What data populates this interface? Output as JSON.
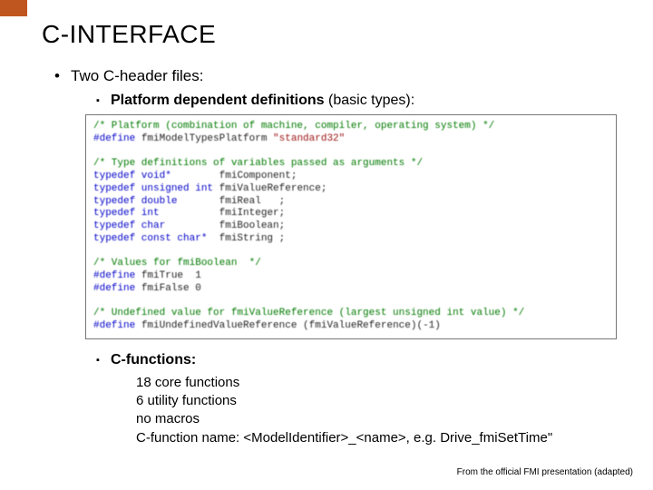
{
  "title": "C-INTERFACE",
  "l1": "Two C-header files:",
  "l2a_bold": "Platform dependent definitions",
  "l2a_rest": " (basic types):",
  "code": {
    "c1": "/* Platform (combination of machine, compiler, operating system) */",
    "d1a": "#define",
    "d1b": " fmiModelTypesPlatform ",
    "d1c": "\"standard32\"",
    "c2": "/* Type definitions of variables passed as arguments */",
    "t1a": "typedef void*",
    "t1b": "        fmiComponent;",
    "t2a": "typedef unsigned int",
    "t2b": " fmiValueReference;",
    "t3a": "typedef double",
    "t3b": "       fmiReal   ;",
    "t4a": "typedef int",
    "t4b": "          fmiInteger;",
    "t5a": "typedef char",
    "t5b": "         fmiBoolean;",
    "t6a": "typedef const char*",
    "t6b": "  fmiString ;",
    "c3": "/* Values for fmiBoolean  */",
    "d2a": "#define",
    "d2b": " fmiTrue  1",
    "d3a": "#define",
    "d3b": " fmiFalse 0",
    "c4": "/* Undefined value for fmiValueReference (largest unsigned int value) */",
    "d4a": "#define",
    "d4b": " fmiUndefinedValueReference (fmiValueReference)(-1)"
  },
  "l2b": "C-functions:",
  "l3a": "18 core functions",
  "l3b": "6 utility functions",
  "l3c": "no macros",
  "l3d": "C-function name: <ModelIdentifier>_<name>, e.g. Drive_fmiSetTime\"",
  "footer": "From the official FMI presentation (adapted)"
}
